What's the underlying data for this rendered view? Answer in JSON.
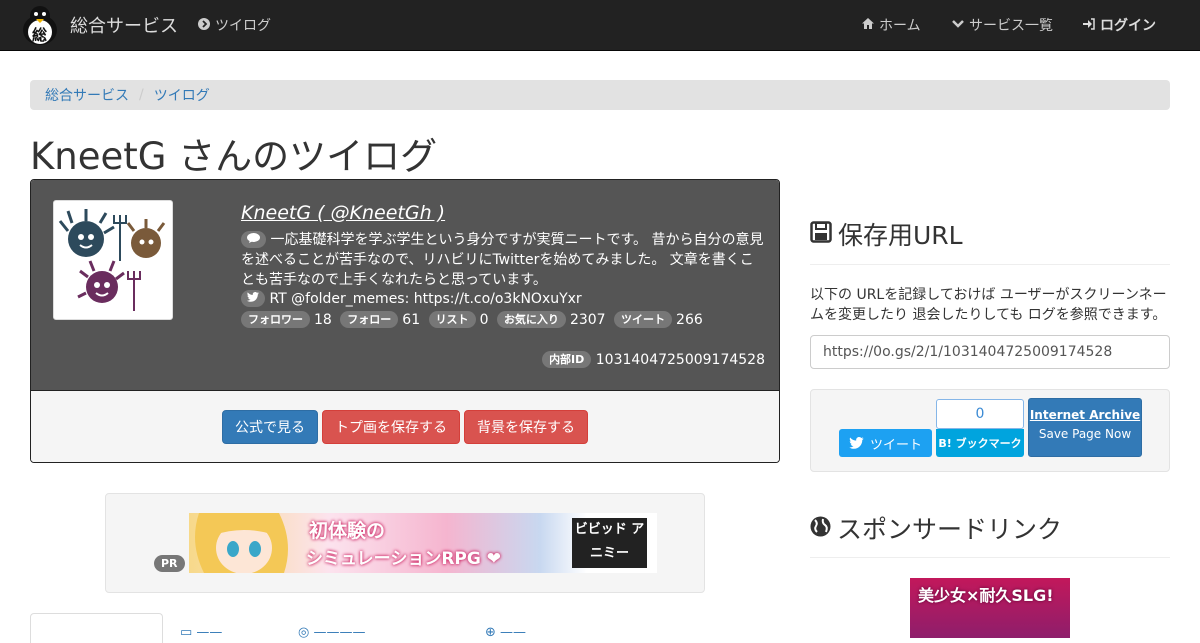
{
  "navbar": {
    "brand": "総合サービス",
    "logo_char": "総",
    "current_service": "ツイログ",
    "home": "ホーム",
    "services": "サービス一覧",
    "login": "ログイン"
  },
  "breadcrumb": {
    "root": "総合サービス",
    "current": "ツイログ"
  },
  "page_title": "KneetG さんのツイログ",
  "profile": {
    "display_name": "KneetG ( @KneetGh )",
    "bio": "一応基礎科学を学ぶ学生という身分ですが実質ニートです。 昔から自分の意見を述べることが苦手なので、リハビリにTwitterを始めてみました。 文章を書くことも苦手なので上手くなれたらと思っています。",
    "rt": "RT @folder_memes: https://t.co/o3kNOxuYxr",
    "stats": [
      {
        "label": "フォロワー",
        "value": "18"
      },
      {
        "label": "フォロー",
        "value": "61"
      },
      {
        "label": "リスト",
        "value": "0"
      },
      {
        "label": "お気に入り",
        "value": "2307"
      },
      {
        "label": "ツイート",
        "value": "266"
      }
    ],
    "internal_id_label": "内部ID",
    "internal_id": "1031404725009174528",
    "buttons": {
      "official": "公式で見る",
      "save_icon": "トプ画を保存する",
      "save_bg": "背景を保存する"
    }
  },
  "pr": {
    "badge": "PR",
    "banner_line1": "初体験の",
    "banner_line2": "シミュレーションRPG ❤",
    "banner_logo": "ビビッド アニミー"
  },
  "side": {
    "save_heading": "保存用URL",
    "save_desc": "以下の URLを記録しておけば ユーザーがスクリーンネームを変更したり 退会したりしても ログを参照できます。",
    "save_url": "https://0o.gs/2/1/1031404725009174528",
    "tweet_btn": "ツイート",
    "hatena_count": "0",
    "hatena_btn": "B! ブックマーク",
    "ia_title": "Internet Archive",
    "ia_sub": "Save Page Now",
    "sponsor_heading": "スポンサードリンク",
    "ad_text": "美少女×耐久SLG!"
  },
  "colors": {
    "navbar": "#222222",
    "link": "#337ab7",
    "danger": "#d9534f",
    "profile_bg": "#555555"
  }
}
